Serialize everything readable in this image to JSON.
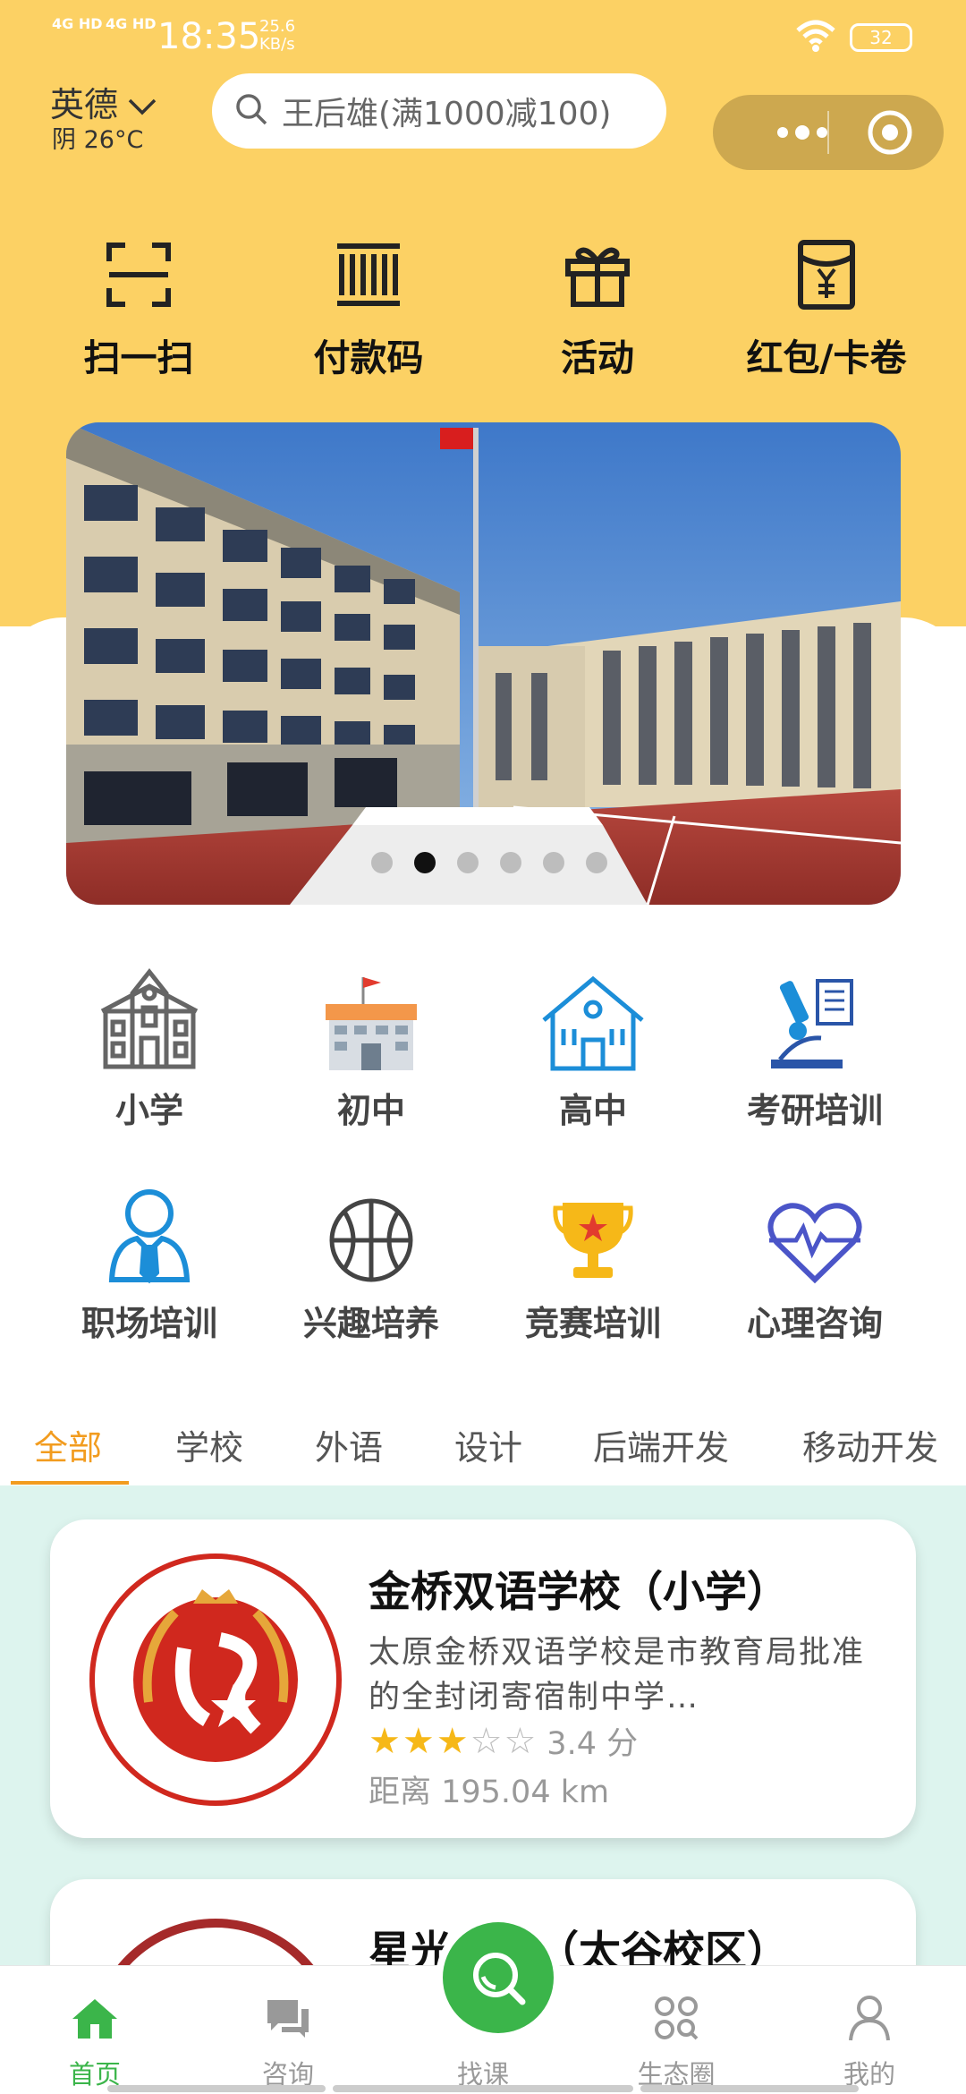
{
  "status_bar": {
    "network1": "4G HD",
    "network2": "4G HD",
    "time": "18:35",
    "speed_value": "25.6",
    "speed_unit": "KB/s",
    "battery": "32"
  },
  "header": {
    "city": "英德",
    "weather": "阴 26°C",
    "search_placeholder": "王后雄(满1000减100)"
  },
  "quick_actions": [
    {
      "label": "扫一扫",
      "icon": "scan-icon"
    },
    {
      "label": "付款码",
      "icon": "barcode-icon"
    },
    {
      "label": "活动",
      "icon": "gift-icon"
    },
    {
      "label": "红包/卡卷",
      "icon": "red-packet-icon"
    }
  ],
  "banner": {
    "dot_count": 6,
    "active_index": 1
  },
  "categories": [
    {
      "label": "小学",
      "icon": "primary-school-icon"
    },
    {
      "label": "初中",
      "icon": "middle-school-icon"
    },
    {
      "label": "高中",
      "icon": "high-school-icon"
    },
    {
      "label": "考研培训",
      "icon": "microscope-icon"
    },
    {
      "label": "职场培训",
      "icon": "worker-icon"
    },
    {
      "label": "兴趣培养",
      "icon": "basketball-icon"
    },
    {
      "label": "竞赛培训",
      "icon": "trophy-icon"
    },
    {
      "label": "心理咨询",
      "icon": "heart-pulse-icon"
    }
  ],
  "tabs": [
    "全部",
    "学校",
    "外语",
    "设计",
    "后端开发",
    "移动开发"
  ],
  "schools": [
    {
      "name": "金桥双语学校（小学）",
      "description": "太原金桥双语学校是市教育局批准的全封闭寄宿制中学…",
      "rating_stars": 3,
      "rating_text": "3.4 分",
      "distance": "距离 195.04 km"
    },
    {
      "name": "星光学校（太谷校区）"
    }
  ],
  "bottom_nav": [
    {
      "label": "首页",
      "icon": "home-icon"
    },
    {
      "label": "咨询",
      "icon": "chat-icon"
    },
    {
      "label": "找课",
      "icon": "search-icon"
    },
    {
      "label": "生态圈",
      "icon": "grid-icon"
    },
    {
      "label": "我的",
      "icon": "user-icon"
    }
  ],
  "colors": {
    "header_bg": "#FCD164",
    "accent_orange": "#F29C1F",
    "accent_green": "#3BB54A",
    "list_bg": "#DDF4EE"
  }
}
